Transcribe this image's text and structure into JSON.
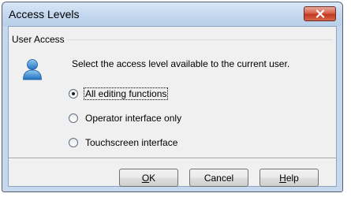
{
  "window": {
    "title": "Access Levels"
  },
  "group": {
    "label": "User Access"
  },
  "description": "Select the access level available to the current user.",
  "options": [
    {
      "label": "All editing functions",
      "checked": true
    },
    {
      "label": "Operator interface only",
      "checked": false
    },
    {
      "label": "Touchscreen interface",
      "checked": false
    }
  ],
  "buttons": {
    "ok": {
      "mnemonic": "O",
      "rest": "K"
    },
    "cancel": {
      "label": "Cancel"
    },
    "help": {
      "mnemonic": "H",
      "rest": "elp"
    }
  },
  "icons": {
    "close": "close-x-icon",
    "user": "user-icon"
  }
}
